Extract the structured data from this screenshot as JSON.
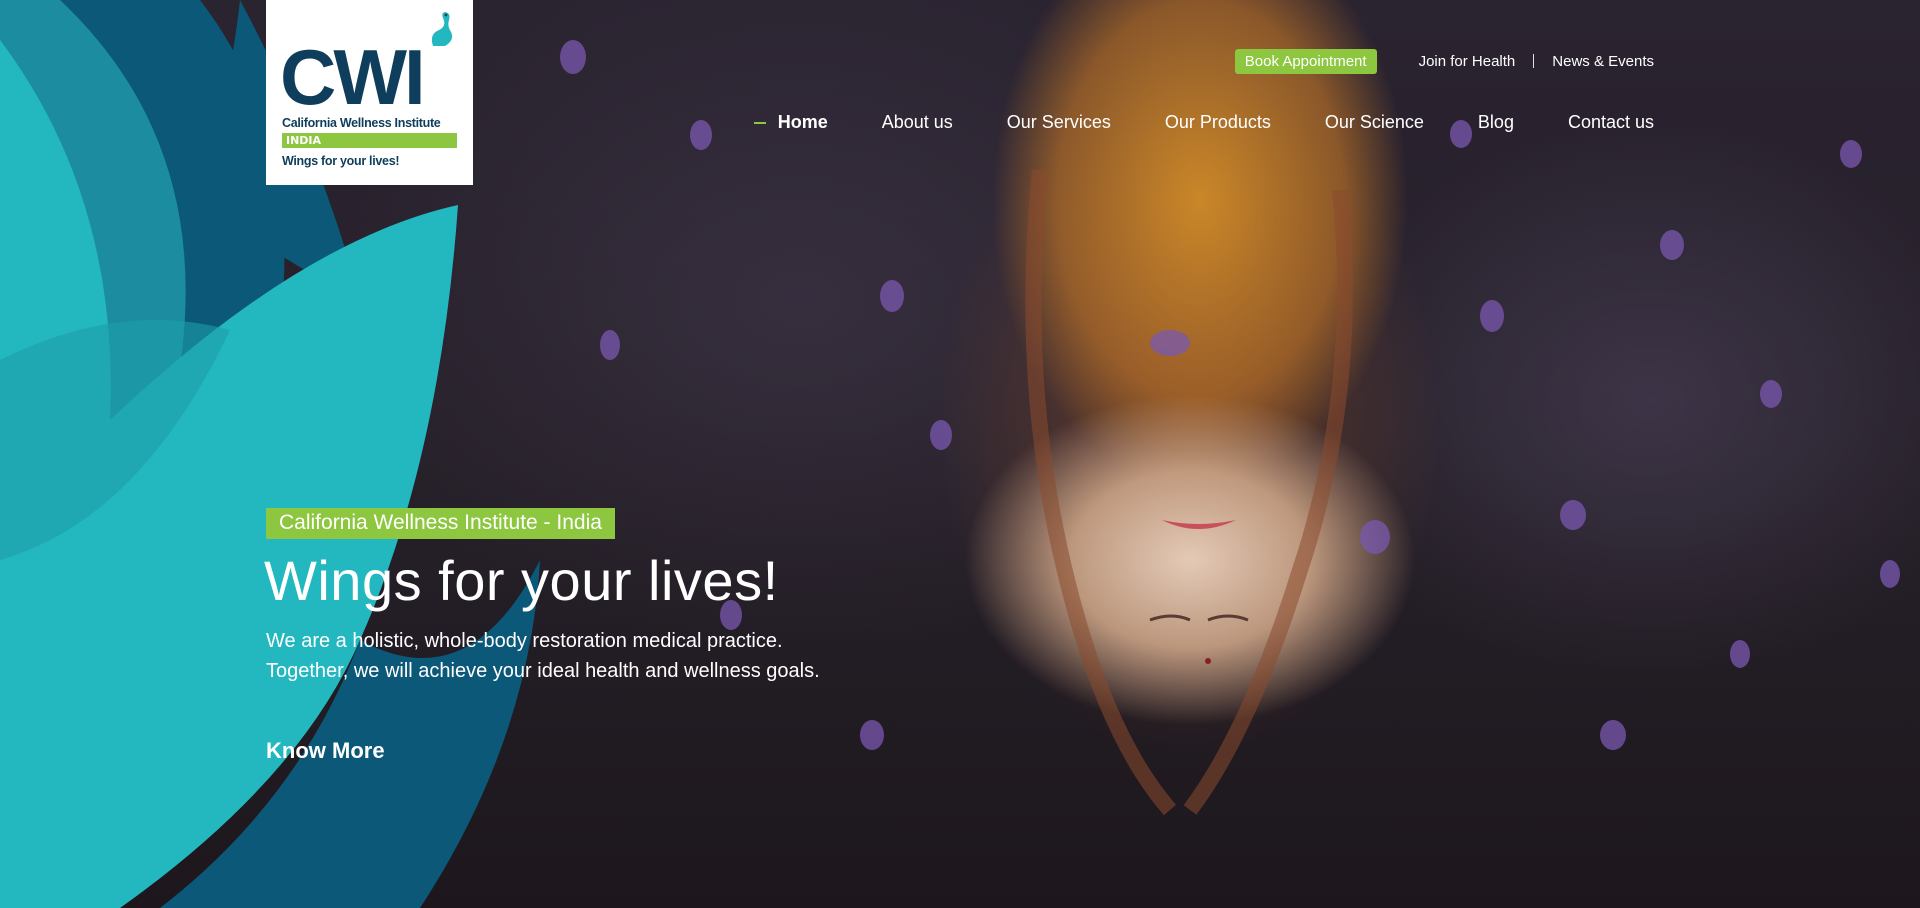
{
  "brand": {
    "logo_mark": "CWI",
    "logo_name": "California Wellness Institute",
    "logo_country": "INDIA",
    "logo_tagline": "Wings for your lives!"
  },
  "top_links": {
    "book_label": "Book Appointment",
    "join_label": "Join for Health",
    "news_label": "News & Events"
  },
  "nav": {
    "items": [
      {
        "label": "Home",
        "active": true
      },
      {
        "label": "About us"
      },
      {
        "label": "Our Services"
      },
      {
        "label": "Our Products"
      },
      {
        "label": "Our Science"
      },
      {
        "label": "Blog"
      },
      {
        "label": "Contact us"
      }
    ]
  },
  "hero": {
    "badge": "California Wellness Institute - India",
    "headline": "Wings for your lives!",
    "description": "We are a holistic, whole-body restoration medical practice. Together, we will achieve your ideal health and wellness goals.",
    "cta_label": "Know More"
  },
  "colors": {
    "accent_green": "#8dc63f",
    "teal": "#23b7bf",
    "navy": "#0f3d5c",
    "deep_blue": "#0b5878"
  },
  "icons": {
    "swan": "swan-icon",
    "arrow": "arrow-right-icon"
  }
}
